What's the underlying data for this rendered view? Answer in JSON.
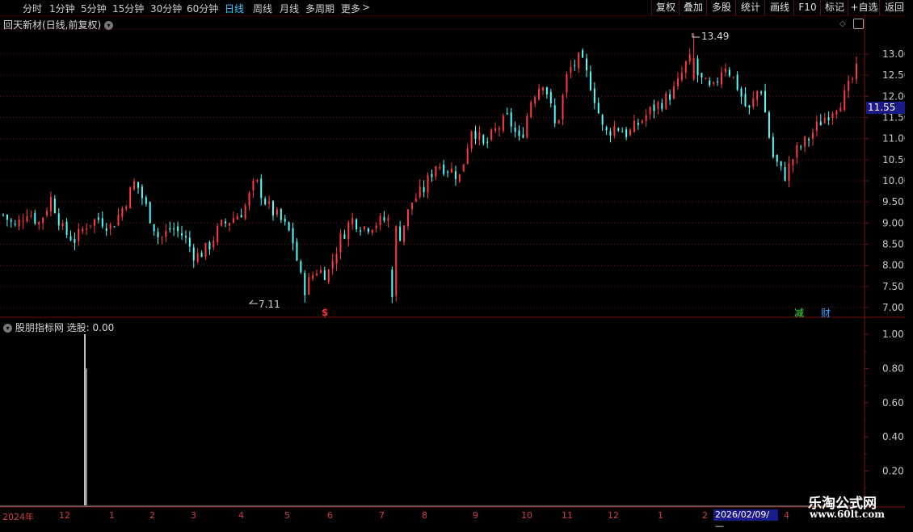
{
  "toolbar": {
    "periods": [
      "分时",
      "1分钟",
      "5分钟",
      "15分钟",
      "30分钟",
      "60分钟",
      "日线",
      "周线",
      "月线",
      "多周期",
      "更多"
    ],
    "active_period": "日线",
    "more_arrow": ">",
    "right_buttons": [
      "复权",
      "叠加",
      "多股",
      "统计",
      "画线",
      "F10",
      "标记",
      "+自选",
      "返回"
    ]
  },
  "main_panel": {
    "title": "回天新材(日线,前复权)",
    "high_marker": "13.49",
    "low_marker": "7.11",
    "current_price": "11.55",
    "price_axis": [
      "13.00",
      "12.50",
      "12.00",
      "11.50",
      "11.00",
      "10.50",
      "10.00",
      "9.50",
      "9.00",
      "8.50",
      "8.00",
      "7.50",
      "7.00"
    ],
    "event_markers": [
      {
        "text": "$",
        "color": "#ff3030"
      },
      {
        "text": "减",
        "color": "#40e040"
      },
      {
        "text": "财",
        "color": "#40a0ff"
      }
    ]
  },
  "indicator_panel": {
    "title": "股朋指标网",
    "value_label": "选股: 0.00",
    "axis": [
      "1.00",
      "0.80",
      "0.60",
      "0.40",
      "0.20"
    ]
  },
  "date_axis": {
    "labels": [
      "2024年",
      "12",
      "1",
      "2",
      "3",
      "4",
      "5",
      "6",
      "7",
      "8",
      "9",
      "10",
      "11",
      "12",
      "1",
      "2"
    ],
    "current_date": "2026/02/09/—",
    "last": "4"
  },
  "watermark": {
    "brand": "乐淘公式网",
    "url": "www.60lt.com"
  },
  "colors": {
    "up": "#ff3b3b",
    "down": "#54ffff",
    "grid": "#7a1010",
    "active": "#3fc7ff"
  },
  "chart_data": {
    "type": "candlestick",
    "price_axis_range": [
      6.9,
      13.7
    ],
    "high": 13.49,
    "low": 7.11,
    "last": 11.55,
    "close_path": [
      9.2,
      8.9,
      9.3,
      9.0,
      9.6,
      8.8,
      8.6,
      9.0,
      9.1,
      8.9,
      9.4,
      10.0,
      9.3,
      8.6,
      8.9,
      8.7,
      8.2,
      8.4,
      8.9,
      9.1,
      9.3,
      10.0,
      9.4,
      9.1,
      8.7,
      7.4,
      7.9,
      7.8,
      8.6,
      9.1,
      8.9,
      9.0,
      9.1,
      8.7,
      9.5,
      9.8,
      10.4,
      10.3,
      10.1,
      11.3,
      10.8,
      11.2,
      11.5,
      10.9,
      12.0,
      12.4,
      11.2,
      12.6,
      12.9,
      12.2,
      11.1,
      11.3,
      11.1,
      11.4,
      11.7,
      11.9,
      12.2,
      12.9,
      12.4,
      12.1,
      12.8,
      12.3,
      11.6,
      12.3,
      10.6,
      10.1,
      10.7,
      11.0,
      11.4,
      11.7,
      12.0,
      12.6
    ],
    "indicator": {
      "name": "选股",
      "value": 0.0,
      "signal_peak": 1.0
    }
  }
}
